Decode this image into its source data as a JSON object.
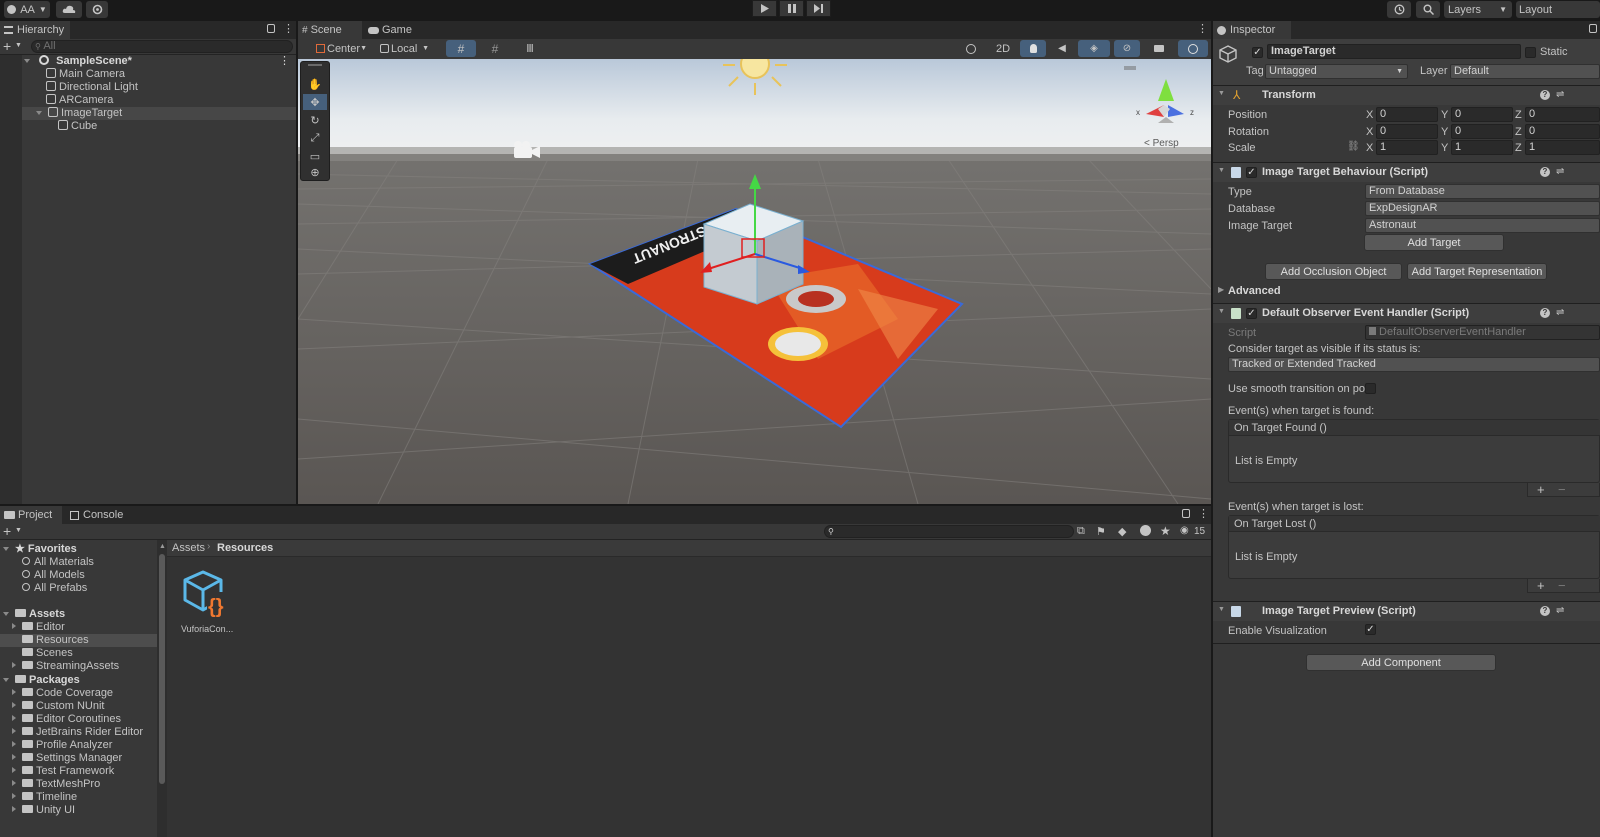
{
  "topbar": {
    "account": "AA",
    "layers": "Layers",
    "layout": "Layout"
  },
  "hierarchy": {
    "tab": "Hierarchy",
    "search_placeholder": "All",
    "scene": "SampleScene*",
    "items": [
      "Main Camera",
      "Directional Light",
      "ARCamera",
      "ImageTarget",
      "Cube"
    ]
  },
  "scene": {
    "tab_scene": "Scene",
    "tab_game": "Game",
    "pivot": "Center",
    "space": "Local",
    "mode_2d": "2D",
    "persp": "< Persp",
    "gizmo_x": "x",
    "gizmo_z": "z",
    "target_text": "ASTRONAUT"
  },
  "project": {
    "tab_project": "Project",
    "tab_console": "Console",
    "hidden_count": "15",
    "favorites": "Favorites",
    "favorite_items": [
      "All Materials",
      "All Models",
      "All Prefabs"
    ],
    "assets": "Assets",
    "asset_items": [
      "Editor",
      "Resources",
      "Scenes",
      "StreamingAssets"
    ],
    "packages": "Packages",
    "package_items": [
      "Code Coverage",
      "Custom NUnit",
      "Editor Coroutines",
      "JetBrains Rider Editor",
      "Profile Analyzer",
      "Settings Manager",
      "Test Framework",
      "TextMeshPro",
      "Timeline",
      "Unity UI"
    ],
    "breadcrumb_root": "Assets",
    "breadcrumb_current": "Resources",
    "file_name": "VuforiaCon..."
  },
  "inspector": {
    "tab": "Inspector",
    "object_name": "ImageTarget",
    "static_label": "Static",
    "tag_label": "Tag",
    "tag_value": "Untagged",
    "layer_label": "Layer",
    "layer_value": "Default",
    "transform": {
      "title": "Transform",
      "position_label": "Position",
      "rotation_label": "Rotation",
      "scale_label": "Scale",
      "x": "X",
      "y": "Y",
      "z": "Z",
      "position": [
        "0",
        "0",
        "0"
      ],
      "rotation": [
        "0",
        "0",
        "0"
      ],
      "scale": [
        "1",
        "1",
        "1"
      ]
    },
    "itb": {
      "title": "Image Target Behaviour (Script)",
      "type_label": "Type",
      "type_value": "From Database",
      "database_label": "Database",
      "database_value": "ExpDesignAR",
      "target_label": "Image Target",
      "target_value": "Astronaut",
      "add_target": "Add Target",
      "add_occlusion": "Add Occlusion Object",
      "add_representation": "Add Target Representation",
      "advanced": "Advanced"
    },
    "doeh": {
      "title": "Default Observer Event Handler (Script)",
      "script_label": "Script",
      "script_value": "DefaultObserverEventHandler",
      "consider_label": "Consider target as visible if its status is:",
      "status_value": "Tracked or Extended Tracked",
      "smooth_label": "Use smooth transition on posi",
      "found_label": "Event(s) when target is found:",
      "found_event": "On Target Found ()",
      "list_empty_1": "List is Empty",
      "lost_label": "Event(s) when target is lost:",
      "lost_event": "On Target Lost ()",
      "list_empty_2": "List is Empty",
      "plus": "+",
      "minus": "−"
    },
    "itp": {
      "title": "Image Target Preview (Script)",
      "enable_label": "Enable Visualization"
    },
    "add_component": "Add Component"
  }
}
